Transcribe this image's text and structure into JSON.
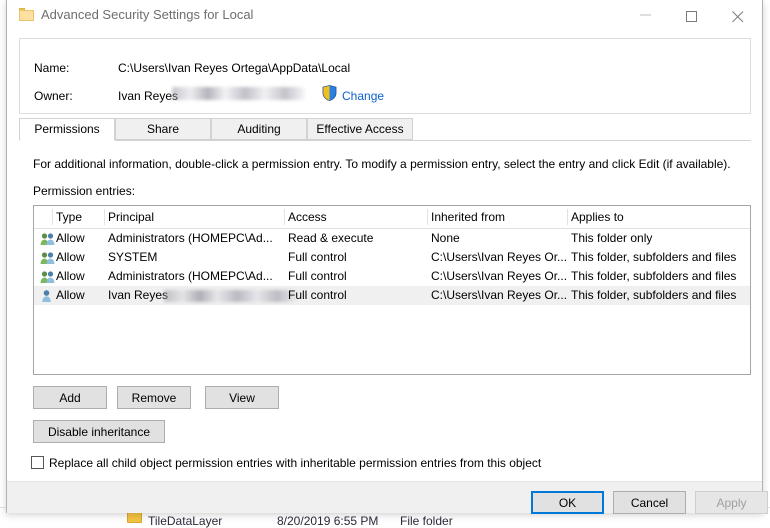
{
  "window": {
    "title": "Advanced Security Settings for Local",
    "icon": "folder-icon",
    "controls": {
      "minimize": "Minimize",
      "maximize": "Maximize",
      "close": "Close"
    }
  },
  "header": {
    "name_label": "Name:",
    "name_value": "C:\\Users\\Ivan Reyes Ortega\\AppData\\Local",
    "owner_label": "Owner:",
    "owner_value": "Ivan Reyes",
    "owner_redacted": true,
    "change_link": "Change",
    "shield_icon": "uac-shield-icon"
  },
  "tabs": [
    {
      "label": "Permissions",
      "active": true
    },
    {
      "label": "Share",
      "active": false
    },
    {
      "label": "Auditing",
      "active": false
    },
    {
      "label": "Effective Access",
      "active": false
    }
  ],
  "main": {
    "info_text": "For additional information, double-click a permission entry. To modify a permission entry, select the entry and click Edit (if available).",
    "entries_label": "Permission entries:"
  },
  "table": {
    "columns": [
      "Type",
      "Principal",
      "Access",
      "Inherited from",
      "Applies to"
    ],
    "rows": [
      {
        "icon": "group-icon",
        "type": "Allow",
        "principal": "Administrators (HOMEPC\\Ad...",
        "access": "Read & execute",
        "inherited_from": "None",
        "applies_to": "This folder only",
        "selected": false,
        "redacted": false
      },
      {
        "icon": "group-icon",
        "type": "Allow",
        "principal": "SYSTEM",
        "access": "Full control",
        "inherited_from": "C:\\Users\\Ivan Reyes Or...",
        "applies_to": "This folder, subfolders and files",
        "selected": false,
        "redacted": false
      },
      {
        "icon": "group-icon",
        "type": "Allow",
        "principal": "Administrators (HOMEPC\\Ad...",
        "access": "Full control",
        "inherited_from": "C:\\Users\\Ivan Reyes Or...",
        "applies_to": "This folder, subfolders and files",
        "selected": false,
        "redacted": false
      },
      {
        "icon": "user-icon",
        "type": "Allow",
        "principal": "Ivan Reyes",
        "access": "Full control",
        "inherited_from": "C:\\Users\\Ivan Reyes Or...",
        "applies_to": "This folder, subfolders and files",
        "selected": true,
        "redacted": true
      }
    ]
  },
  "actions": {
    "add": "Add",
    "remove": "Remove",
    "view": "View",
    "disable_inheritance": "Disable inheritance"
  },
  "replace_option": {
    "label": "Replace all child object permission entries with inheritable permission entries from this object",
    "checked": false
  },
  "footer": {
    "ok": "OK",
    "cancel": "Cancel",
    "apply": "Apply",
    "apply_disabled": true,
    "ok_is_default": true
  },
  "background_explorer": {
    "name": "TileDataLayer",
    "date": "8/20/2019 6:55 PM",
    "type": "File folder",
    "icon": "folder-icon"
  },
  "colors": {
    "accent": "#0078d7",
    "link": "#0b63ce",
    "selection": "#f0f0f0",
    "button_face": "#e1e1e1",
    "folder_yellow": "#f5c342"
  }
}
